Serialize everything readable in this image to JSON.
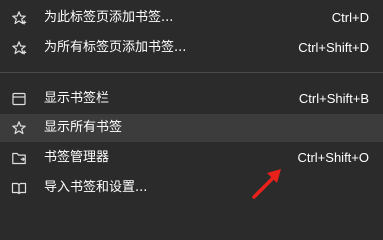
{
  "menu": {
    "items": [
      {
        "label": "为此标签页添加书签...",
        "shortcut": "Ctrl+D",
        "icon": "star-icon"
      },
      {
        "label": "为所有标签页添加书签...",
        "shortcut": "Ctrl+Shift+D",
        "icon": "star-icon"
      },
      {
        "label": "显示书签栏",
        "shortcut": "Ctrl+Shift+B",
        "icon": "bookmark-bar-icon"
      },
      {
        "label": "显示所有书签",
        "shortcut": "",
        "icon": "star-icon"
      },
      {
        "label": "书签管理器",
        "shortcut": "Ctrl+Shift+O",
        "icon": "folder-icon"
      },
      {
        "label": "导入书签和设置...",
        "shortcut": "",
        "icon": "book-icon"
      }
    ]
  },
  "colors": {
    "background": "#2b2b2b",
    "highlight": "#3c3c3c",
    "text": "#ffffff",
    "separator": "#4a4a4a",
    "annotation_arrow": "#e8221b"
  }
}
